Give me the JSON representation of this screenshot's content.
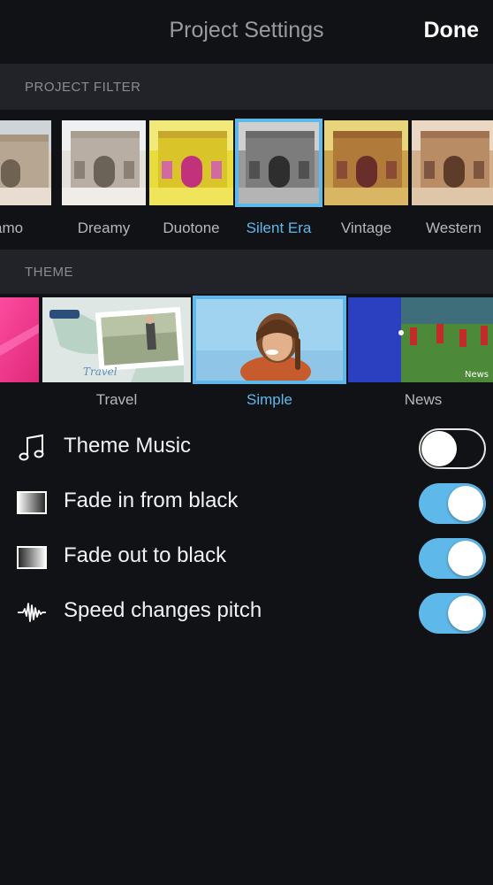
{
  "navbar": {
    "title": "Project Settings",
    "done_label": "Done"
  },
  "filter_section": {
    "header": "PROJECT FILTER",
    "items": [
      {
        "label": "amo",
        "selected": false
      },
      {
        "label": "Dreamy",
        "selected": false
      },
      {
        "label": "Duotone",
        "selected": false
      },
      {
        "label": "Silent Era",
        "selected": true
      },
      {
        "label": "Vintage",
        "selected": false
      },
      {
        "label": "Western",
        "selected": false
      }
    ]
  },
  "theme_section": {
    "header": "THEME",
    "items": [
      {
        "label": "",
        "selected": false
      },
      {
        "label": "Travel",
        "selected": false,
        "thumb_text": "Travel"
      },
      {
        "label": "Simple",
        "selected": true
      },
      {
        "label": "News",
        "selected": false,
        "thumb_text": "News"
      }
    ]
  },
  "settings": [
    {
      "label": "Theme Music",
      "icon": "music-note-icon",
      "on": false
    },
    {
      "label": "Fade in from black",
      "icon": "fade-gradient-icon",
      "on": true
    },
    {
      "label": "Fade out to black",
      "icon": "fade-gradient-icon",
      "on": true
    },
    {
      "label": "Speed changes pitch",
      "icon": "waveform-icon",
      "on": true
    }
  ],
  "colors": {
    "accent": "#5fb8ea",
    "background": "#111216",
    "section_header_bg": "#222329"
  }
}
